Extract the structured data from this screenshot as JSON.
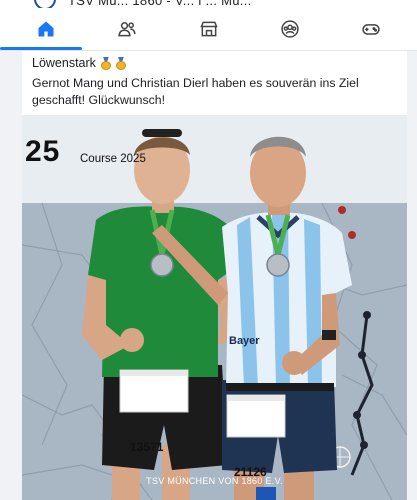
{
  "header_peek": {
    "text": "TSV Mü... 1860 - V... i ... Mü..."
  },
  "nav": {
    "items": [
      {
        "name": "home",
        "active": true
      },
      {
        "name": "friends",
        "active": false
      },
      {
        "name": "marketplace",
        "active": false
      },
      {
        "name": "groups",
        "active": false
      },
      {
        "name": "gaming",
        "active": false
      }
    ]
  },
  "post": {
    "title": "Löwenstark",
    "medal_count": 2,
    "text": "Gernot Mang und Christian Dierl haben es souverän ins Ziel geschafft! Glückwunsch!",
    "photo": {
      "big_number": "25",
      "label": "Course 2025",
      "bib_left": "13571",
      "bib_right": "21126",
      "shirt_text": "Bayer",
      "caption": "TSV MÜNCHEN VON 1860 E.V."
    }
  },
  "colors": {
    "accent": "#1877f2",
    "background": "#f0f2f5",
    "green_jersey": "#1f8a3a",
    "blue_jersey": "#8cc3ea"
  }
}
